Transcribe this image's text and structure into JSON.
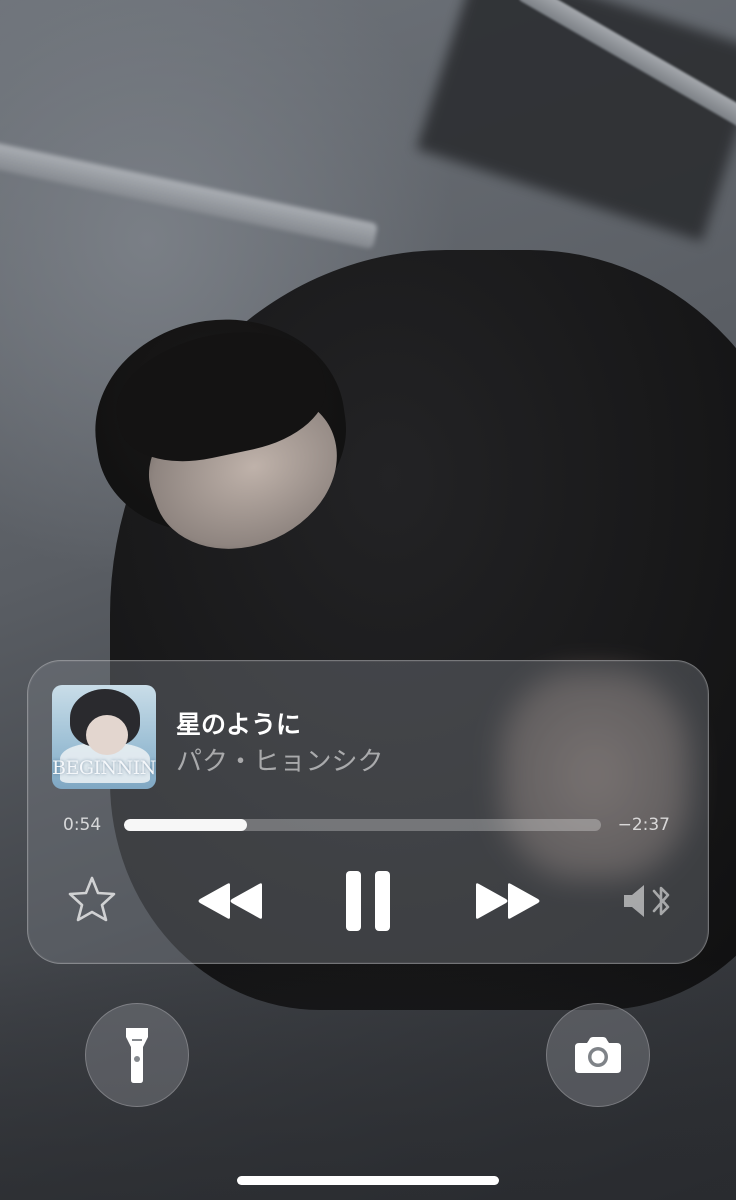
{
  "now_playing": {
    "album_art_text": "BEGINNING",
    "song_title": "星のように",
    "artist": "パク・ヒョンシク",
    "elapsed": "0:54",
    "remaining": "−2:37",
    "progress_fraction": 0.257
  },
  "controls": {
    "favorite_icon": "star-outline-icon",
    "rewind_icon": "rewind-icon",
    "play_pause_icon": "pause-icon",
    "fast_forward_icon": "fast-forward-icon",
    "audio_output_icon": "speaker-bluetooth-icon"
  },
  "lockscreen_buttons": {
    "left_icon": "flashlight-icon",
    "right_icon": "camera-icon"
  },
  "colors": {
    "primary_text": "#ffffff",
    "secondary_text": "#b8babd",
    "progress_fill": "#f7f7f7"
  }
}
